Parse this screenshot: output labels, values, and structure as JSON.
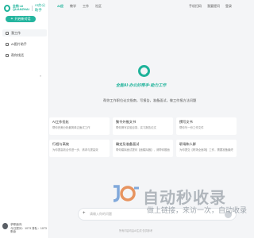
{
  "brand": {
    "name_line1": "全栈·AI",
    "name_line2": "QUANZHAI",
    "sub": "AI办公助手"
  },
  "sidebar": {
    "new_chat_label": "开启新对话",
    "items": [
      {
        "label": "我工作"
      },
      {
        "label": "AI图片助手"
      },
      {
        "label": "帮你找话"
      }
    ],
    "user": {
      "name": "求职面向",
      "meta": "今日提问：1073 排队：1073 剩余"
    }
  },
  "topnav": {
    "tabs": [
      "AI应",
      "教学",
      "工作",
      "社区"
    ],
    "active_index": 0,
    "right_links": [
      "手机扫码",
      "我要提问",
      "登录"
    ]
  },
  "hero": {
    "slogan": "全能AI·办公好帮手·助力工作",
    "description": "帮你工作职位论文指南，写报告，准备面试，做工作报方法问题"
  },
  "cards": [
    {
      "title": "AI工作优化",
      "desc": "帮你完美分析最简单过面试工作"
    },
    {
      "title": "聚令外推文书",
      "desc": "帮你撰写实验目录，实习报告论文"
    },
    {
      "title": "撰写文书",
      "desc": "帮你写一份工作文件"
    },
    {
      "title": "行程与高效",
      "desc": "为你提高效合作进一步，请求与提高效"
    },
    {
      "title": "确定及准备面试",
      "desc": "帮你模拟面试提问【面模拟器】，请帮你题面一"
    },
    {
      "title": "职场和人群",
      "desc": "为你提交【职场全面场】工作，需要准备最终做工"
    }
  ],
  "input": {
    "placeholder": "请输入你的问题"
  },
  "footer": {
    "note": "所有内容均由AI生成 仅供参考"
  },
  "watermark": {
    "title": "自动秒收录",
    "subtitle": "做上链接，来访一次，自动收录"
  },
  "colors": {
    "accent": "#1fb39a",
    "button": "#25b59f"
  }
}
